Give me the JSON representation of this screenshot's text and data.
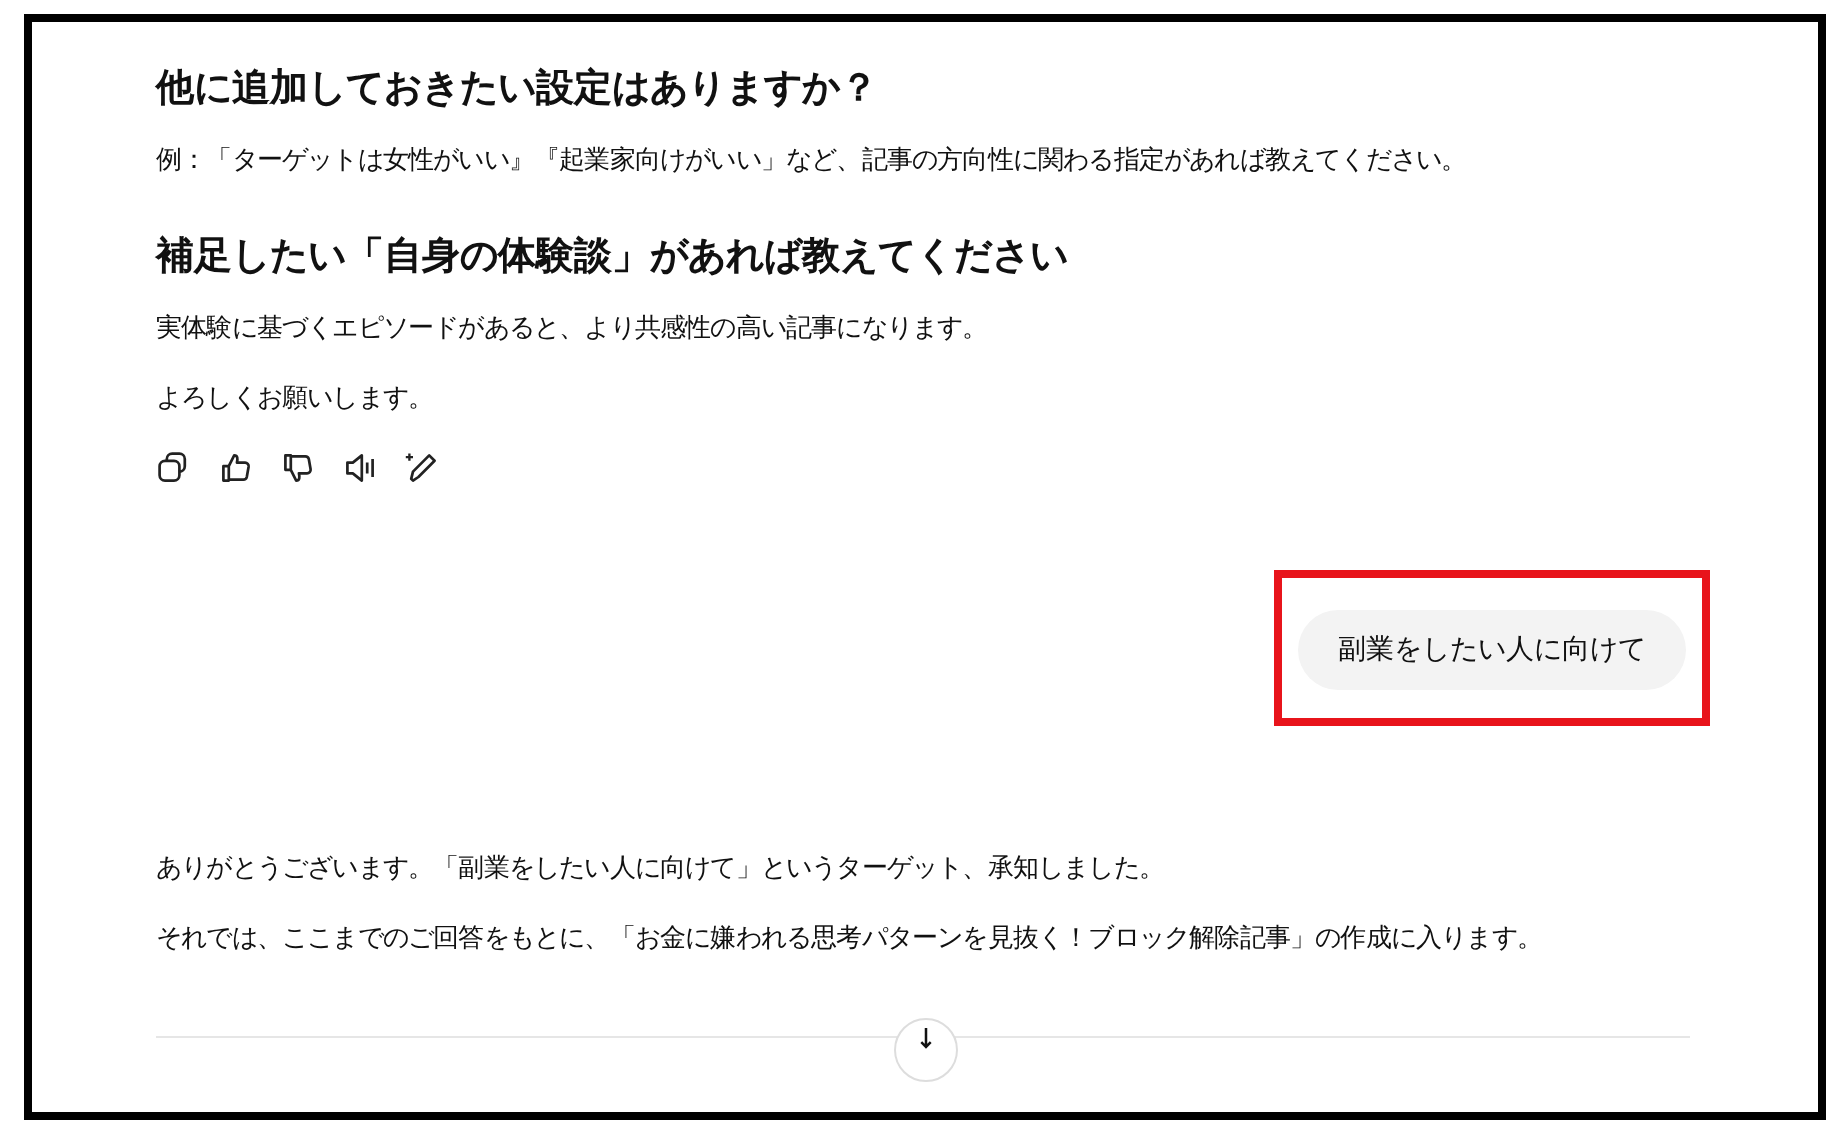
{
  "assistant_message": {
    "blocks": [
      {
        "kind": "heading",
        "text": "他に追加しておきたい設定はありますか？"
      },
      {
        "kind": "paragraph",
        "text": "例：「ターゲットは女性がいい』『起業家向けがいい」など、記事の方向性に関わる指定があれば教えてください。"
      },
      {
        "kind": "heading",
        "text": "補足したい「自身の体験談」があれば教えてください"
      },
      {
        "kind": "paragraph",
        "text": "実体験に基づくエピソードがあると、より共感性の高い記事になります。"
      },
      {
        "kind": "paragraph",
        "text": "よろしくお願いします。"
      }
    ]
  },
  "user_message": {
    "text": "副業をしたい人に向けて",
    "highlighted": true
  },
  "reply_message": {
    "blocks": [
      {
        "kind": "paragraph",
        "text": "ありがとうございます。「副業をしたい人に向けて」というターゲット、承知しました。"
      },
      {
        "kind": "paragraph",
        "text": "それでは、ここまでのご回答をもとに、「お金に嫌われる思考パターンを見抜く！ブロック解除記事」の作成に入ります。"
      }
    ]
  }
}
